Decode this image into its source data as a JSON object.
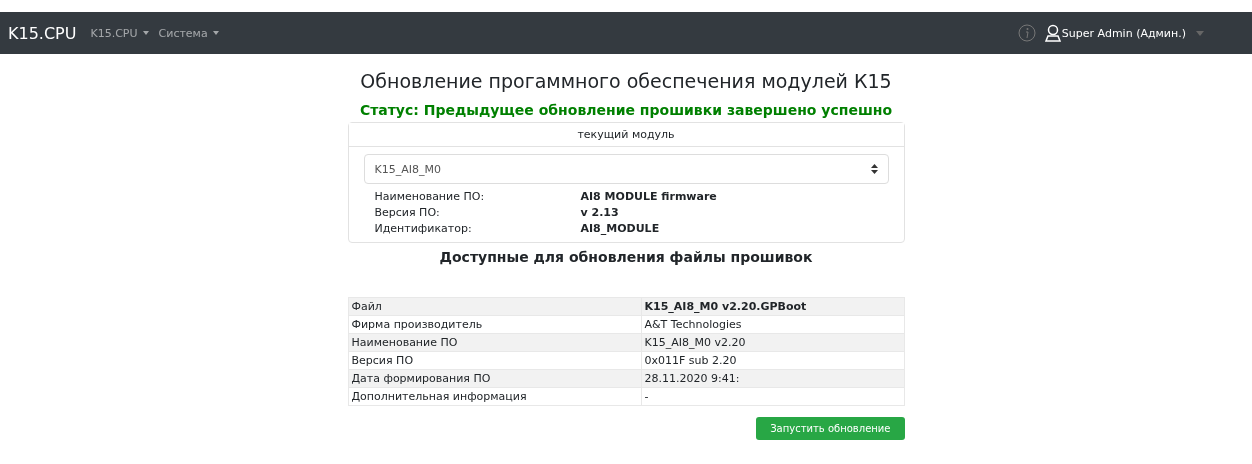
{
  "navbar": {
    "brand": "K15.CPU",
    "menus": [
      {
        "label": "K15.CPU"
      },
      {
        "label": "Система"
      }
    ],
    "user": "Super Admin (Админ.)"
  },
  "title": "Обновление прогаммного обеспечения модулей К15",
  "status": "Статус: Предыдущее обновление прошивки завершено успешно",
  "module_card": {
    "header": "текущий модуль",
    "select_value": "K15_AI8_M0",
    "fields": [
      {
        "label": "Наименование ПО:",
        "value": "AI8 MODULE firmware"
      },
      {
        "label": "Версия ПО:",
        "value": "v 2.13"
      },
      {
        "label": "Идентификатор:",
        "value": "AI8_MODULE"
      }
    ]
  },
  "files_heading": "Доступные для обновления файлы прошивок",
  "files_table": {
    "rows": [
      {
        "label": "Файл",
        "value": "K15_AI8_M0 v2.20.GPBoot",
        "bold": true
      },
      {
        "label": "Фирма производитель",
        "value": "A&T Technologies",
        "bold": false
      },
      {
        "label": "Наименование ПО",
        "value": "K15_AI8_M0 v2.20",
        "bold": false
      },
      {
        "label": "Версия ПО",
        "value": "0x011F sub 2.20",
        "bold": false
      },
      {
        "label": "Дата формирования ПО",
        "value": "28.11.2020 9:41:",
        "bold": false
      },
      {
        "label": "Дополнительная информация",
        "value": "-",
        "bold": false
      }
    ]
  },
  "update_button": "Запустить обновление"
}
